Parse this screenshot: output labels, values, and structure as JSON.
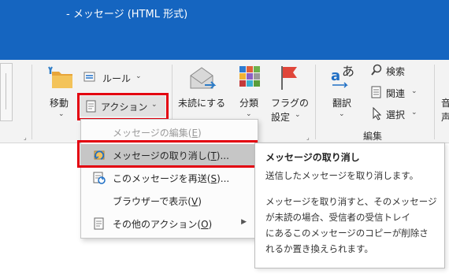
{
  "window": {
    "title": "-  メッセージ (HTML 形式)"
  },
  "ribbon": {
    "move_label": "移動",
    "rules_label": "ルール",
    "actions_label": "アクション",
    "mark_unread_label": "未読にする",
    "categorize_label": "分類",
    "follow_up_label_1": "フラグの",
    "follow_up_label_2": "設定",
    "translate_label": "翻訳",
    "search_label": "検索",
    "related_label": "関連",
    "select_label": "選択",
    "editing_group_label": "編集",
    "partial_label": "音",
    "partial_label2": "声"
  },
  "actions_menu": {
    "items": [
      {
        "label": "メッセージの編集(E)",
        "accel": "E",
        "enabled": false
      },
      {
        "label": "メッセージの取り消し(T)...",
        "accel": "T",
        "enabled": true
      },
      {
        "label": "このメッセージを再送(S)...",
        "accel": "S",
        "enabled": true
      },
      {
        "label": "ブラウザーで表示(V)",
        "accel": "V",
        "enabled": true
      },
      {
        "label": "その他のアクション(O)",
        "accel": "O",
        "enabled": true,
        "has_submenu": true
      }
    ]
  },
  "tooltip": {
    "title": "メッセージの取り消し",
    "line1": "送信したメッセージを取り消します。",
    "line2": "メッセージを取り消すと、そのメッセージ",
    "line3": "が未読の場合、受信者の受信トレイ",
    "line4": "にあるこのメッセージのコピーが削除さ",
    "line5": "れるか置き換えられます。"
  },
  "colors": {
    "titlebar": "#1565c0",
    "highlight": "#e3000f",
    "ribbon_bg": "#f3f3f3",
    "menu_hover": "#c6c6c6"
  }
}
